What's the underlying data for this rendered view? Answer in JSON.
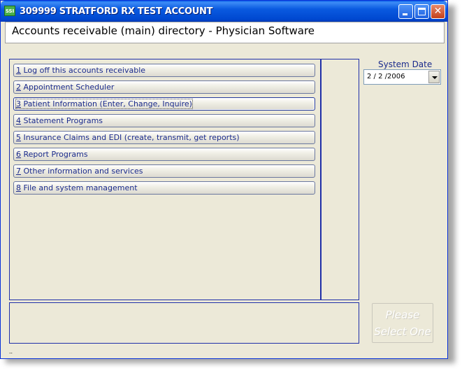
{
  "window": {
    "title": "309999 STRATFORD RX TEST ACCOUNT",
    "app_icon_text": "SSI",
    "buttons": {
      "minimize": "minimize-icon",
      "maximize": "maximize-icon",
      "close": "close-icon"
    }
  },
  "header": {
    "title": "Accounts receivable (main) directory - Physician Software"
  },
  "menu": [
    {
      "key": "1",
      "label": " Log off this accounts receivable"
    },
    {
      "key": "2",
      "label": " Appointment Scheduler"
    },
    {
      "key": "3",
      "label": " Patient Information (Enter, Change, Inquire)"
    },
    {
      "key": "4",
      "label": " Statement Programs"
    },
    {
      "key": "5",
      "label": " Insurance Claims and EDI (create, transmit, get reports)"
    },
    {
      "key": "6",
      "label": " Report Programs"
    },
    {
      "key": "7",
      "label": " Other information and services"
    },
    {
      "key": "8",
      "label": " File and system management"
    }
  ],
  "focused_item": "3",
  "system_date": {
    "label": "System Date",
    "value": "2 / 2 /2006"
  },
  "please_select": {
    "line1": "Please",
    "line2": "Select One"
  },
  "status_text": "..",
  "colors": {
    "window_bg": "#ece9d8",
    "titlebar": "#0a5ae0",
    "accent_text": "#1a2a8c",
    "frame_border": "#1f2fa8"
  }
}
